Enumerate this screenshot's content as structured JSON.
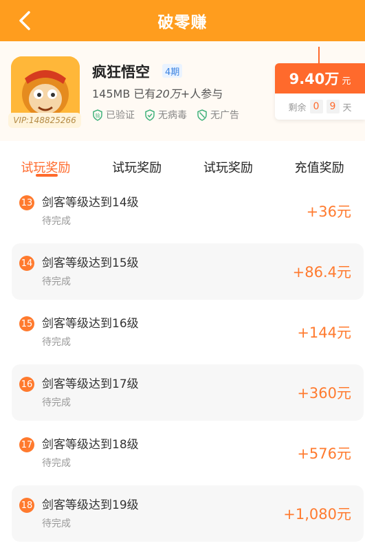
{
  "nav": {
    "title": "破零赚",
    "back_icon": "chevron-left-icon"
  },
  "app": {
    "name": "疯狂悟空",
    "period": "4期",
    "size": "145MB",
    "participants_prefix": "已有",
    "participants_num": "20万+",
    "participants_suffix": "人参与",
    "vip": "VIP:148825266",
    "badges": [
      "已验证",
      "无病毒",
      "无广告"
    ]
  },
  "reward": {
    "amount": "9.40万",
    "unit": "元",
    "remain_label": "剩余",
    "remain_digits": [
      "0",
      "9"
    ],
    "remain_unit": "天"
  },
  "tabs": [
    "试玩奖励",
    "试玩奖励",
    "试玩奖励",
    "充值奖励"
  ],
  "tasks": [
    {
      "num": "13",
      "title": "剑客等级达到14级",
      "status": "待完成",
      "amount": "+36元"
    },
    {
      "num": "14",
      "title": "剑客等级达到15级",
      "status": "待完成",
      "amount": "+86.4元"
    },
    {
      "num": "15",
      "title": "剑客等级达到16级",
      "status": "待完成",
      "amount": "+144元"
    },
    {
      "num": "16",
      "title": "剑客等级达到17级",
      "status": "待完成",
      "amount": "+360元"
    },
    {
      "num": "17",
      "title": "剑客等级达到18级",
      "status": "待完成",
      "amount": "+576元"
    },
    {
      "num": "18",
      "title": "剑客等级达到19级",
      "status": "待完成",
      "amount": "+1,080元"
    }
  ],
  "colors": {
    "primary": "#ff9d1e",
    "accent": "#ff6a2c",
    "amount": "#ff7a2e"
  }
}
